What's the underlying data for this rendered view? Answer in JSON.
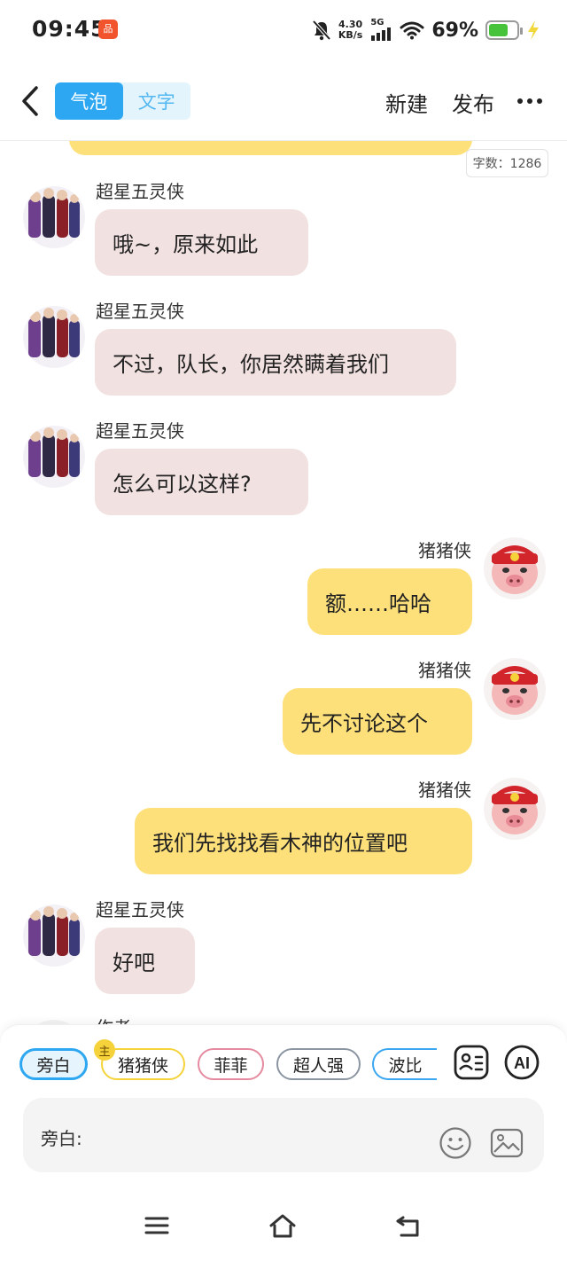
{
  "status_bar": {
    "time": "09:45",
    "app_badge": "品",
    "net_speed_value": "4.30",
    "net_speed_unit": "KB/s",
    "signal_type": "5G",
    "battery_percent": "69%",
    "battery_level": 0.69,
    "battery_color": "#46c33a"
  },
  "header": {
    "tabs": [
      {
        "label": "气泡",
        "active": true
      },
      {
        "label": "文字",
        "active": false
      }
    ],
    "new_label": "新建",
    "publish_label": "发布",
    "accent_color": "#2ea7f2"
  },
  "word_count": "字数：1286",
  "messages": [
    {
      "side": "left",
      "sender": "超星五灵侠",
      "text": "哦~，原来如此"
    },
    {
      "side": "left",
      "sender": "超星五灵侠",
      "text": "不过，队长，你居然瞒着我们"
    },
    {
      "side": "left",
      "sender": "超星五灵侠",
      "text": "怎么可以这样?"
    },
    {
      "side": "right",
      "sender": "猪猪侠",
      "text": "额……哈哈"
    },
    {
      "side": "right",
      "sender": "猪猪侠",
      "text": "先不讨论这个"
    },
    {
      "side": "right",
      "sender": "猪猪侠",
      "text": "我们先找找看木神的位置吧"
    },
    {
      "side": "left",
      "sender": "超星五灵侠",
      "text": "好吧"
    },
    {
      "side": "left",
      "sender": "作者",
      "text": ""
    }
  ],
  "composer": {
    "chips": [
      {
        "label": "旁白"
      },
      {
        "label": "猪猪侠"
      },
      {
        "label": "菲菲"
      },
      {
        "label": "超人强"
      },
      {
        "label": "波比"
      }
    ],
    "main_badge": "主",
    "ai_label": "AI",
    "input_label": "旁白:"
  },
  "colors": {
    "left_bubble": "#f2e1e1",
    "right_bubble": "#fde07a"
  }
}
